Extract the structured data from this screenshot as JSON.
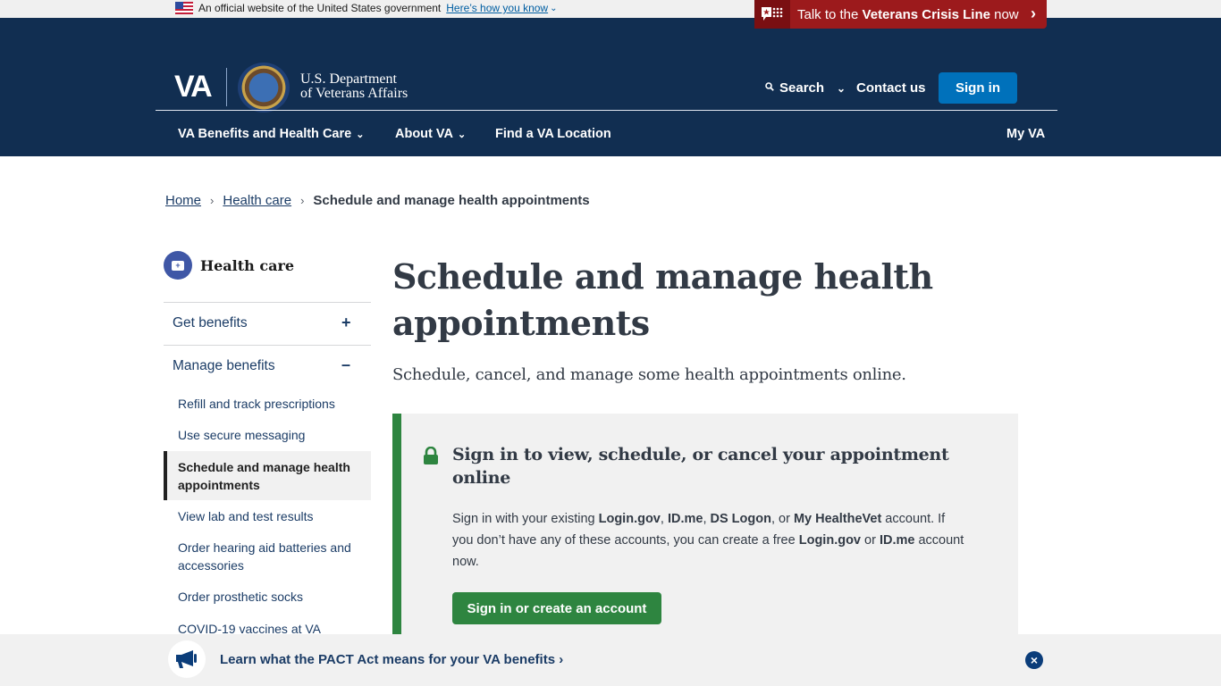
{
  "gov_banner": {
    "text": "An official website of the United States government",
    "link": "Here’s how you know",
    "flag_icon": "us-flag-icon"
  },
  "crisis_line": {
    "prefix": "Talk to the ",
    "bold": "Veterans Crisis Line",
    "suffix": " now",
    "icon": "crisis-chat-icon",
    "color": "#9c1a1c"
  },
  "header": {
    "logo_text": "VA",
    "dept_line1": "U.S. Department",
    "dept_line2": "of Veterans Affairs",
    "search_label": "Search",
    "contact_label": "Contact us",
    "signin_label": "Sign in",
    "bg_color": "#112e51"
  },
  "nav": {
    "items": [
      {
        "label": "VA Benefits and Health Care",
        "dropdown": true
      },
      {
        "label": "About VA",
        "dropdown": true
      },
      {
        "label": "Find a VA Location",
        "dropdown": false
      }
    ],
    "right_item": "My VA"
  },
  "breadcrumb": {
    "items": [
      "Home",
      "Health care"
    ],
    "current": "Schedule and manage health appointments"
  },
  "sidebar": {
    "title": "Health care",
    "sections": [
      {
        "label": "Get benefits",
        "state": "collapsed"
      },
      {
        "label": "Manage benefits",
        "state": "expanded"
      }
    ],
    "links": [
      "Refill and track prescriptions",
      "Use secure messaging",
      "Schedule and manage health appointments",
      "View lab and test results",
      "Order hearing aid batteries and accessories",
      "Order prosthetic socks",
      "COVID-19 vaccines at VA"
    ],
    "active_index": 2
  },
  "main": {
    "title": "Schedule and manage health appointments",
    "lead": "Schedule, cancel, and manage some health appointments online.",
    "cta": {
      "heading": "Sign in to view, schedule, or cancel your appointment online",
      "body_parts": [
        {
          "t": "Sign in with your existing ",
          "b": false
        },
        {
          "t": "Login.gov",
          "b": true
        },
        {
          "t": ", ",
          "b": false
        },
        {
          "t": "ID.me",
          "b": true
        },
        {
          "t": ", ",
          "b": false
        },
        {
          "t": "DS Logon",
          "b": true
        },
        {
          "t": ", or ",
          "b": false
        },
        {
          "t": "My HealtheVet",
          "b": true
        },
        {
          "t": " account. If you don’t have any of these accounts, you can create a free ",
          "b": false
        },
        {
          "t": "Login.gov",
          "b": true
        },
        {
          "t": " or ",
          "b": false
        },
        {
          "t": "ID.me",
          "b": true
        },
        {
          "t": " account now.",
          "b": false
        }
      ],
      "button": "Sign in or create an account",
      "accent_color": "#2e8540"
    }
  },
  "promo_banner": {
    "text": "Learn what the PACT Act means for your VA benefits",
    "icon": "megaphone-icon"
  }
}
